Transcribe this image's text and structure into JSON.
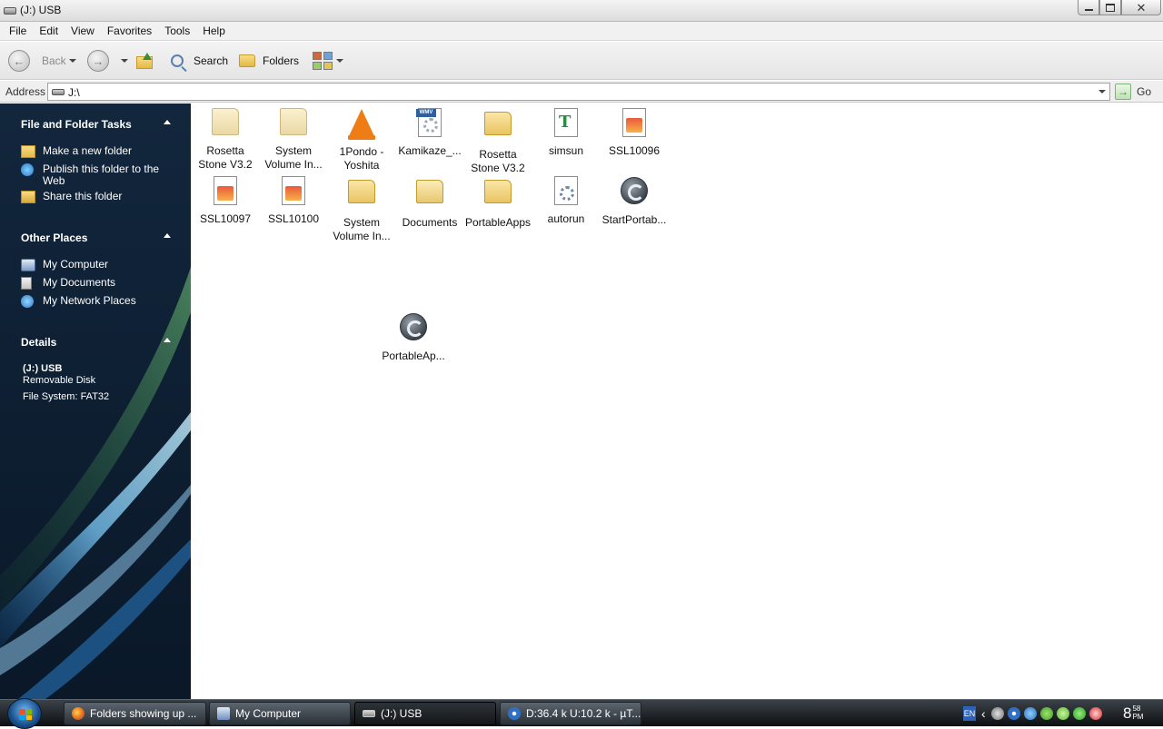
{
  "window": {
    "title": "(J:) USB",
    "buttons": {
      "minimize": "minimize",
      "maximize": "maximize",
      "close": "close"
    }
  },
  "menu": [
    "File",
    "Edit",
    "View",
    "Favorites",
    "Tools",
    "Help"
  ],
  "toolbar": {
    "back": "Back",
    "search": "Search",
    "folders": "Folders"
  },
  "address": {
    "label": "Address",
    "value": "J:\\",
    "go": "Go"
  },
  "sidebar": {
    "file_tasks": {
      "title": "File and Folder Tasks",
      "items": [
        {
          "label": "Make a new folder",
          "icon": "new-folder-icon"
        },
        {
          "label": "Publish this folder to the Web",
          "icon": "publish-web-icon"
        },
        {
          "label": "Share this folder",
          "icon": "share-folder-icon"
        }
      ]
    },
    "other_places": {
      "title": "Other Places",
      "items": [
        {
          "label": "My Computer",
          "icon": "my-computer-icon"
        },
        {
          "label": "My Documents",
          "icon": "my-documents-icon"
        },
        {
          "label": "My Network Places",
          "icon": "network-places-icon"
        }
      ]
    },
    "details": {
      "title": "Details",
      "name": "(J:) USB",
      "type": "Removable Disk",
      "filesystem": "File System: FAT32"
    }
  },
  "files": [
    {
      "line1": "Rosetta",
      "line2": "Stone V3.2",
      "icon": "folder-icon"
    },
    {
      "line1": "System",
      "line2": "Volume In...",
      "icon": "folder-icon"
    },
    {
      "line1": "1Pondo -",
      "line2": "Yoshita",
      "icon": "vlc-cone-icon"
    },
    {
      "line1": "Kamikaze_...",
      "line2": "",
      "icon": "wmv-file-icon"
    },
    {
      "line1": "Rosetta",
      "line2": "Stone V3.2",
      "icon": "folder-icon"
    },
    {
      "line1": "simsun",
      "line2": "",
      "icon": "font-file-icon"
    },
    {
      "line1": "SSL10096",
      "line2": "",
      "icon": "image-file-icon"
    },
    {
      "line1": "SSL10097",
      "line2": "",
      "icon": "image-file-icon"
    },
    {
      "line1": "SSL10100",
      "line2": "",
      "icon": "image-file-icon"
    },
    {
      "line1": "System",
      "line2": "Volume In...",
      "icon": "folder-icon"
    },
    {
      "line1": "Documents",
      "line2": "",
      "icon": "folder-icon"
    },
    {
      "line1": "PortableApps",
      "line2": "",
      "icon": "folder-icon"
    },
    {
      "line1": "autorun",
      "line2": "",
      "icon": "settings-file-icon"
    },
    {
      "line1": "StartPortab...",
      "line2": "",
      "icon": "portableapps-icon"
    },
    {
      "line1": "PortableAp...",
      "line2": "",
      "icon": "portableapps-icon"
    }
  ],
  "taskbar": {
    "buttons": [
      {
        "label": "Folders showing up ...",
        "icon": "firefox-icon"
      },
      {
        "label": "My Computer",
        "icon": "my-computer-icon"
      },
      {
        "label": "(J:) USB",
        "icon": "usb-drive-icon"
      },
      {
        "label": "D:36.4 k U:10.2 k - µT...",
        "icon": "utorrent-icon"
      }
    ],
    "tray": {
      "language": "EN"
    },
    "clock": {
      "hour": "8",
      "minutes": "58",
      "ampm": "PM"
    }
  }
}
